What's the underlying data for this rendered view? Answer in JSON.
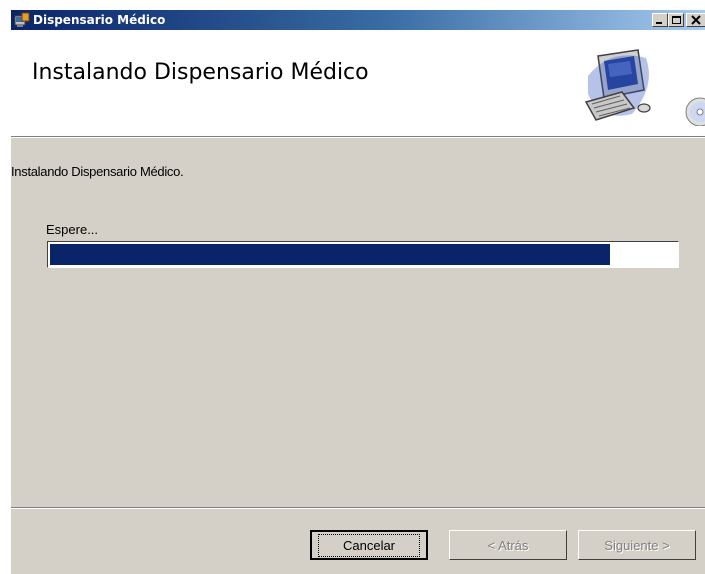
{
  "window": {
    "title": "Dispensario Médico"
  },
  "header": {
    "title": "Instalando Dispensario Médico"
  },
  "body": {
    "status_text": "Instalando Dispensario Médico.",
    "wait_label": "Espere...",
    "progress_fraction": 0.895
  },
  "buttons": {
    "cancel": "Cancelar",
    "back": "< Atrás",
    "next": "Siguiente >"
  },
  "colors": {
    "titlebar_start": "#0a246a",
    "progress_fill": "#0a246a",
    "face": "#d4d0c8"
  },
  "icons": {
    "app": "installer-icon",
    "header": "computer-cd-icon",
    "minimize": "minimize-icon",
    "maximize": "maximize-icon",
    "close": "close-icon"
  }
}
